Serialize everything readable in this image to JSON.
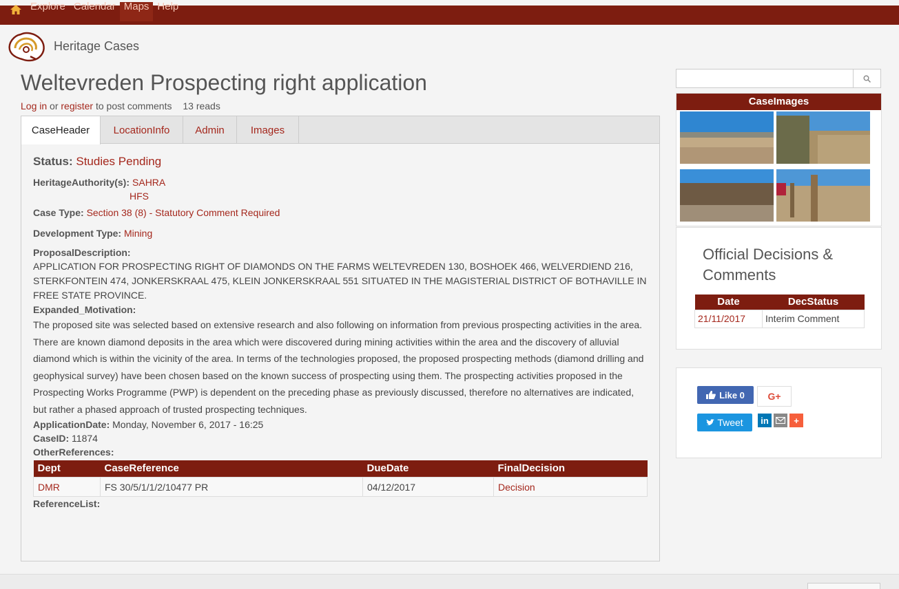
{
  "nav": {
    "items": [
      {
        "label": "Explore"
      },
      {
        "label": "Calendar"
      },
      {
        "label": "Maps"
      },
      {
        "label": "Help"
      }
    ]
  },
  "brand": {
    "site_name": "Heritage Cases"
  },
  "page": {
    "title": "Weltevreden Prospecting right application",
    "login_label": "Log in",
    "or_text": " or ",
    "register_label": "register",
    "post_comments_text": " to post comments",
    "reads": "13 reads"
  },
  "tabs": [
    {
      "label": "CaseHeader"
    },
    {
      "label": "LocationInfo"
    },
    {
      "label": "Admin"
    },
    {
      "label": "Images"
    }
  ],
  "case": {
    "status_label": "Status:",
    "status_value": "Studies Pending",
    "authority_label": "HeritageAuthority(s):",
    "authorities": [
      "SAHRA",
      "HFS"
    ],
    "case_type_label": "Case Type:",
    "case_type_value": "Section 38 (8) - Statutory Comment Required",
    "dev_type_label": "Development Type:",
    "dev_type_value": "Mining",
    "proposal_label": "ProposalDescription:",
    "proposal_text": "APPLICATION FOR PROSPECTING RIGHT OF DIAMONDS ON THE FARMS WELTEVREDEN 130, BOSHOEK 466, WELVERDIEND 216, STERKFONTEIN 474, JONKERSKRAAL 475, KLEIN JONKERSKRAAL 551 SITUATED IN THE MAGISTERIAL DISTRICT OF BOTHAVILLE IN FREE STATE PROVINCE.",
    "motivation_label": "Expanded_Motivation:",
    "motivation_text": "The proposed site was selected based on extensive research and also following on information from previous prospecting activities in the area. There are known diamond deposits in the area which were discovered during mining activities within the area and the discovery of alluvial diamond which is within the vicinity of the area. In terms of the technologies proposed, the proposed prospecting methods (diamond drilling and geophysical survey) have been chosen based on the known success of prospecting using them. The prospecting activities proposed in the Prospecting Works Programme (PWP) is dependent on the preceding phase as previously discussed, therefore no alternatives are indicated, but rather a phased approach of trusted prospecting techniques.",
    "app_date_label": "ApplicationDate:",
    "app_date_value": "Monday, November 6, 2017 - 16:25",
    "case_id_label": "CaseID:",
    "case_id_value": "11874",
    "other_refs_label": "OtherReferences:",
    "refs_headers": [
      "Dept",
      "CaseReference",
      "DueDate",
      "FinalDecision"
    ],
    "refs_rows": [
      {
        "dept": "DMR",
        "ref": "FS 30/5/1/1/2/10477 PR",
        "due": "04/12/2017",
        "decision": "Decision"
      }
    ],
    "ref_list_label": "ReferenceList:"
  },
  "sidebar": {
    "search_placeholder": "",
    "images_title": "CaseImages",
    "decisions_title": "Official Decisions & Comments",
    "dec_headers": [
      "Date",
      "DecStatus"
    ],
    "dec_rows": [
      {
        "date": "21/11/2017",
        "status": "Interim Comment"
      }
    ],
    "social": {
      "like_label": "Like 0",
      "gplus_label": "G+",
      "tweet_label": "Tweet",
      "linkedin_label": "in",
      "plus_label": "+"
    }
  },
  "colors": {
    "brand": "#7d1d10",
    "link": "#a4271c"
  }
}
